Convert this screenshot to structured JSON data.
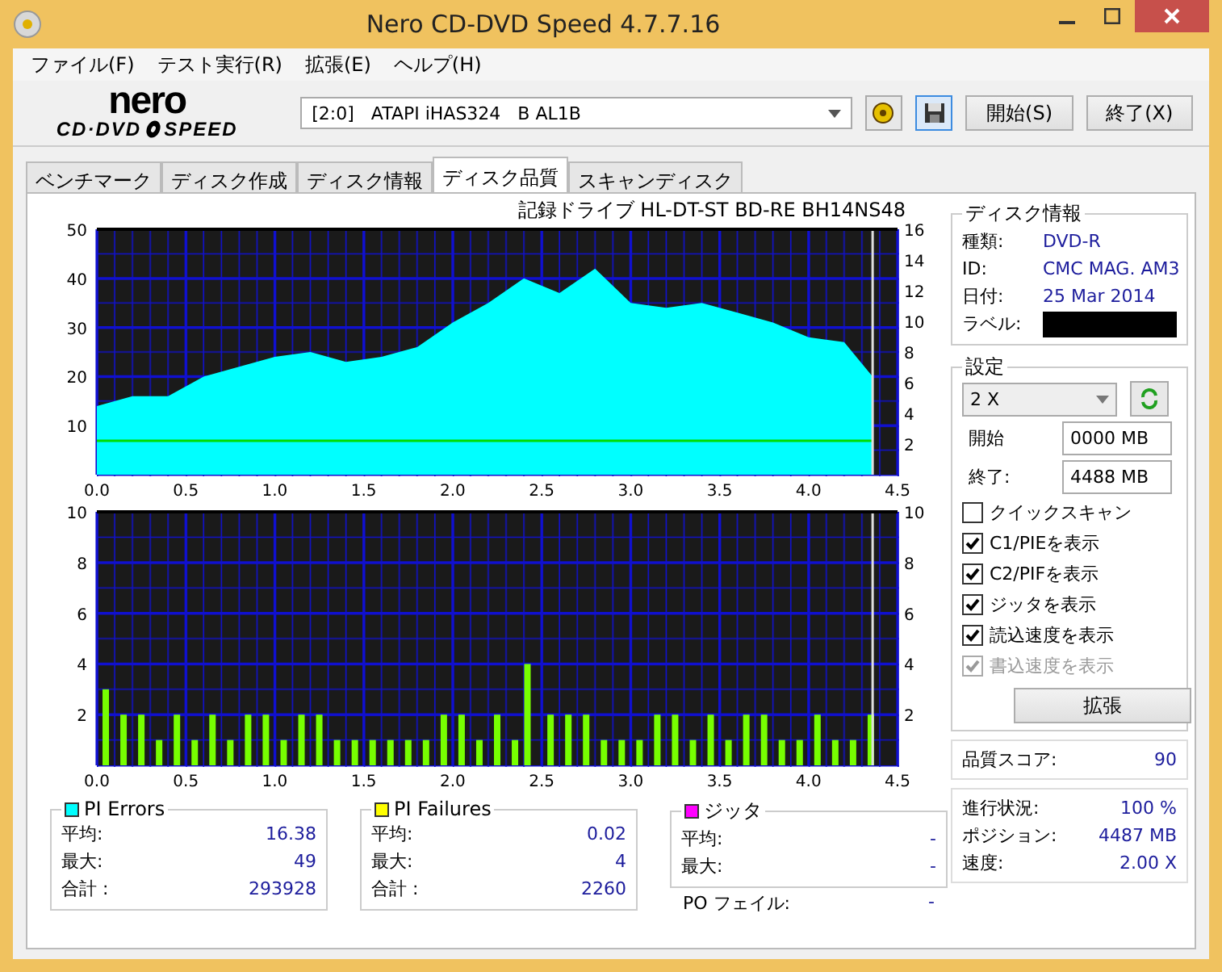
{
  "window": {
    "title": "Nero CD-DVD Speed 4.7.7.16"
  },
  "menu": [
    "ファイル(F)",
    "テスト実行(R)",
    "拡張(E)",
    "ヘルプ(H)"
  ],
  "logo": {
    "brand": "nero",
    "line_start": "CD·DVD",
    "line_end": "SPEED"
  },
  "toolbar": {
    "drive": "[2:0]   ATAPI iHAS324   B AL1B",
    "buttons": [
      "開始(S)",
      "終了(X)"
    ]
  },
  "tabs": [
    {
      "label": "ベンチマーク",
      "selected": false
    },
    {
      "label": "ディスク作成",
      "selected": false
    },
    {
      "label": "ディスク情報",
      "selected": false
    },
    {
      "label": "ディスク品質",
      "selected": true
    },
    {
      "label": "スキャンディスク",
      "selected": false
    }
  ],
  "errors_chart": {
    "title": "記録ドライブ HL-DT-ST BD-RE  BH14NS48",
    "right_axis_labels": [
      "16",
      "14",
      "12",
      "10",
      "8",
      "6",
      "4",
      "2"
    ],
    "chart_data": {
      "type": "area",
      "grid": true,
      "ref_lines": [
        {
          "axis": "x",
          "value": 4.36
        }
      ],
      "x": [
        0,
        0.2,
        0.4,
        0.6,
        0.8,
        1.0,
        1.2,
        1.4,
        1.6,
        1.8,
        2.0,
        2.2,
        2.4,
        2.6,
        2.8,
        3.0,
        3.2,
        3.4,
        3.6,
        3.8,
        4.0,
        4.2,
        4.36
      ],
      "xlim": [
        0,
        4.5
      ],
      "ylim": [
        0,
        50
      ],
      "xticks": [
        {
          "value": 0,
          "label": "0.0"
        },
        0.5,
        {
          "value": 1,
          "label": "1.0"
        },
        1.5,
        {
          "value": 2,
          "label": "2.0"
        },
        2.5,
        {
          "value": 3,
          "label": "3.0"
        },
        3.5,
        {
          "value": 4,
          "label": "4.0"
        },
        4.5
      ],
      "yticks": [
        10,
        20,
        30,
        40,
        50
      ],
      "series": [
        {
          "name": "PI Errors",
          "color": "#00ffff",
          "values": [
            14,
            16,
            16,
            20,
            22,
            24,
            25,
            23,
            24,
            26,
            31,
            35,
            40,
            37,
            42,
            35,
            34,
            35,
            33,
            31,
            28,
            27,
            20
          ]
        },
        {
          "type": "line",
          "color": "#00dd00",
          "values": [
            6.9,
            6.9,
            6.9,
            6.9,
            6.9,
            6.9,
            6.9,
            6.9,
            6.9,
            6.9,
            6.9,
            6.9,
            6.9,
            6.9,
            6.9,
            6.9,
            6.9,
            6.9,
            6.9,
            6.9,
            6.9,
            6.9,
            6.9
          ]
        }
      ]
    }
  },
  "failures_chart": {
    "right_axis_labels": [
      "10",
      "8",
      "6",
      "4",
      "2"
    ],
    "chart_data": {
      "type": "bar",
      "grid": true,
      "ref_lines": [
        {
          "axis": "x",
          "value": 4.36
        }
      ],
      "x": [
        0.05,
        0.15,
        0.25,
        0.35,
        0.45,
        0.55,
        0.65,
        0.75,
        0.85,
        0.95,
        1.05,
        1.15,
        1.25,
        1.35,
        1.45,
        1.55,
        1.65,
        1.75,
        1.85,
        1.95,
        2.05,
        2.15,
        2.25,
        2.35,
        2.42,
        2.55,
        2.65,
        2.75,
        2.85,
        2.95,
        3.05,
        3.15,
        3.25,
        3.35,
        3.45,
        3.55,
        3.65,
        3.75,
        3.85,
        3.95,
        4.05,
        4.15,
        4.25,
        4.35
      ],
      "xlim": [
        0,
        4.5
      ],
      "ylim": [
        0,
        10
      ],
      "xticks": [
        {
          "value": 0,
          "label": "0.0"
        },
        0.5,
        {
          "value": 1,
          "label": "1.0"
        },
        1.5,
        {
          "value": 2,
          "label": "2.0"
        },
        2.5,
        {
          "value": 3,
          "label": "3.0"
        },
        3.5,
        {
          "value": 4,
          "label": "4.0"
        },
        4.5
      ],
      "yticks": [
        {
          "value": 2,
          "label": "2"
        },
        {
          "value": 4,
          "label": "4"
        },
        {
          "value": 6,
          "label": "6"
        },
        {
          "value": 8,
          "label": "8"
        },
        {
          "value": 10,
          "label": "10"
        }
      ],
      "series": [
        {
          "name": "PI Failures",
          "color": "#77ff00",
          "values": [
            3,
            2,
            2,
            1,
            2,
            1,
            2,
            1,
            2,
            2,
            1,
            2,
            2,
            1,
            1,
            1,
            1,
            1,
            1,
            2,
            2,
            1,
            2,
            1,
            4,
            2,
            2,
            2,
            1,
            1,
            1,
            2,
            2,
            1,
            2,
            1,
            2,
            2,
            1,
            1,
            2,
            1,
            1,
            2
          ]
        }
      ]
    }
  },
  "disc_info": {
    "title": "ディスク情報",
    "rows": [
      {
        "label": "種類:",
        "value": "DVD-R"
      },
      {
        "label": "ID:",
        "value": "CMC MAG. AM3"
      },
      {
        "label": "日付:",
        "value": "25 Mar 2014"
      }
    ],
    "label_row": {
      "label": "ラベル:"
    }
  },
  "settings": {
    "title": "設定",
    "speed": "2 X",
    "start_label": "開始",
    "start_value": "0000 MB",
    "end_label": "終了:",
    "end_value": "4488 MB",
    "options": [
      {
        "label": "クイックスキャン",
        "checked": false,
        "disabled": false
      },
      {
        "label": "C1/PIEを表示",
        "checked": true,
        "disabled": false
      },
      {
        "label": "C2/PIFを表示",
        "checked": true,
        "disabled": false
      },
      {
        "label": "ジッタを表示",
        "checked": true,
        "disabled": false
      },
      {
        "label": "読込速度を表示",
        "checked": true,
        "disabled": false
      },
      {
        "label": "書込速度を表示",
        "checked": true,
        "disabled": true
      }
    ],
    "advanced_button": "拡張"
  },
  "quality": {
    "label": "品質スコア:",
    "value": "90"
  },
  "progress": [
    {
      "label": "進行状況:",
      "value": "100 %"
    },
    {
      "label": "ポジション:",
      "value": "4487 MB"
    },
    {
      "label": "速度:",
      "value": "2.00 X"
    }
  ],
  "stats": [
    {
      "color": "#00ffff",
      "rows": [
        {
          "label": "平均:",
          "value": "16.38"
        },
        {
          "label": "最大:",
          "value": "49"
        },
        {
          "label": "合計 :",
          "value": "293928"
        }
      ]
    },
    {
      "color": "#ffff00",
      "rows": [
        {
          "label": "平均:",
          "value": "0.02"
        },
        {
          "label": "最大:",
          "value": "4"
        },
        {
          "label": "合計 :",
          "value": "2260"
        }
      ]
    },
    {
      "title": "ジッタ",
      "color": "#ff00ff",
      "rows": [
        {
          "label": "平均:",
          "value": "-"
        },
        {
          "label": "最大:",
          "value": "-"
        }
      ]
    }
  ],
  "po_fail": {
    "label": "PO フェイル:",
    "value": "-"
  }
}
